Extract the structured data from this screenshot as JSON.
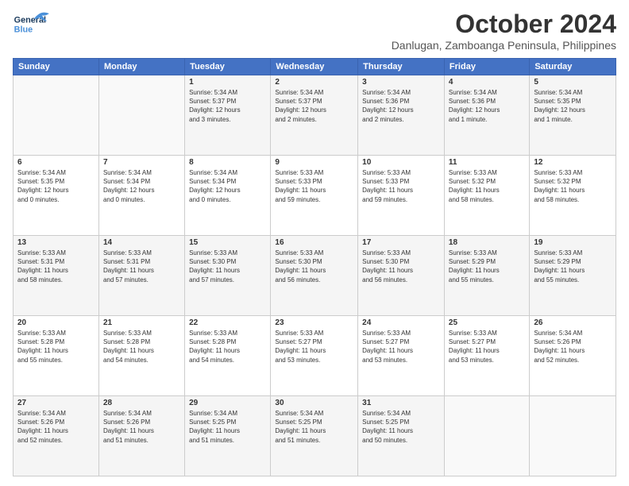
{
  "header": {
    "logo_general": "General",
    "logo_blue": "Blue",
    "month_title": "October 2024",
    "location": "Danlugan, Zamboanga Peninsula, Philippines"
  },
  "days_of_week": [
    "Sunday",
    "Monday",
    "Tuesday",
    "Wednesday",
    "Thursday",
    "Friday",
    "Saturday"
  ],
  "weeks": [
    [
      {
        "day": "",
        "info": ""
      },
      {
        "day": "",
        "info": ""
      },
      {
        "day": "1",
        "info": "Sunrise: 5:34 AM\nSunset: 5:37 PM\nDaylight: 12 hours\nand 3 minutes."
      },
      {
        "day": "2",
        "info": "Sunrise: 5:34 AM\nSunset: 5:37 PM\nDaylight: 12 hours\nand 2 minutes."
      },
      {
        "day": "3",
        "info": "Sunrise: 5:34 AM\nSunset: 5:36 PM\nDaylight: 12 hours\nand 2 minutes."
      },
      {
        "day": "4",
        "info": "Sunrise: 5:34 AM\nSunset: 5:36 PM\nDaylight: 12 hours\nand 1 minute."
      },
      {
        "day": "5",
        "info": "Sunrise: 5:34 AM\nSunset: 5:35 PM\nDaylight: 12 hours\nand 1 minute."
      }
    ],
    [
      {
        "day": "6",
        "info": "Sunrise: 5:34 AM\nSunset: 5:35 PM\nDaylight: 12 hours\nand 0 minutes."
      },
      {
        "day": "7",
        "info": "Sunrise: 5:34 AM\nSunset: 5:34 PM\nDaylight: 12 hours\nand 0 minutes."
      },
      {
        "day": "8",
        "info": "Sunrise: 5:34 AM\nSunset: 5:34 PM\nDaylight: 12 hours\nand 0 minutes."
      },
      {
        "day": "9",
        "info": "Sunrise: 5:33 AM\nSunset: 5:33 PM\nDaylight: 11 hours\nand 59 minutes."
      },
      {
        "day": "10",
        "info": "Sunrise: 5:33 AM\nSunset: 5:33 PM\nDaylight: 11 hours\nand 59 minutes."
      },
      {
        "day": "11",
        "info": "Sunrise: 5:33 AM\nSunset: 5:32 PM\nDaylight: 11 hours\nand 58 minutes."
      },
      {
        "day": "12",
        "info": "Sunrise: 5:33 AM\nSunset: 5:32 PM\nDaylight: 11 hours\nand 58 minutes."
      }
    ],
    [
      {
        "day": "13",
        "info": "Sunrise: 5:33 AM\nSunset: 5:31 PM\nDaylight: 11 hours\nand 58 minutes."
      },
      {
        "day": "14",
        "info": "Sunrise: 5:33 AM\nSunset: 5:31 PM\nDaylight: 11 hours\nand 57 minutes."
      },
      {
        "day": "15",
        "info": "Sunrise: 5:33 AM\nSunset: 5:30 PM\nDaylight: 11 hours\nand 57 minutes."
      },
      {
        "day": "16",
        "info": "Sunrise: 5:33 AM\nSunset: 5:30 PM\nDaylight: 11 hours\nand 56 minutes."
      },
      {
        "day": "17",
        "info": "Sunrise: 5:33 AM\nSunset: 5:30 PM\nDaylight: 11 hours\nand 56 minutes."
      },
      {
        "day": "18",
        "info": "Sunrise: 5:33 AM\nSunset: 5:29 PM\nDaylight: 11 hours\nand 55 minutes."
      },
      {
        "day": "19",
        "info": "Sunrise: 5:33 AM\nSunset: 5:29 PM\nDaylight: 11 hours\nand 55 minutes."
      }
    ],
    [
      {
        "day": "20",
        "info": "Sunrise: 5:33 AM\nSunset: 5:28 PM\nDaylight: 11 hours\nand 55 minutes."
      },
      {
        "day": "21",
        "info": "Sunrise: 5:33 AM\nSunset: 5:28 PM\nDaylight: 11 hours\nand 54 minutes."
      },
      {
        "day": "22",
        "info": "Sunrise: 5:33 AM\nSunset: 5:28 PM\nDaylight: 11 hours\nand 54 minutes."
      },
      {
        "day": "23",
        "info": "Sunrise: 5:33 AM\nSunset: 5:27 PM\nDaylight: 11 hours\nand 53 minutes."
      },
      {
        "day": "24",
        "info": "Sunrise: 5:33 AM\nSunset: 5:27 PM\nDaylight: 11 hours\nand 53 minutes."
      },
      {
        "day": "25",
        "info": "Sunrise: 5:33 AM\nSunset: 5:27 PM\nDaylight: 11 hours\nand 53 minutes."
      },
      {
        "day": "26",
        "info": "Sunrise: 5:34 AM\nSunset: 5:26 PM\nDaylight: 11 hours\nand 52 minutes."
      }
    ],
    [
      {
        "day": "27",
        "info": "Sunrise: 5:34 AM\nSunset: 5:26 PM\nDaylight: 11 hours\nand 52 minutes."
      },
      {
        "day": "28",
        "info": "Sunrise: 5:34 AM\nSunset: 5:26 PM\nDaylight: 11 hours\nand 51 minutes."
      },
      {
        "day": "29",
        "info": "Sunrise: 5:34 AM\nSunset: 5:25 PM\nDaylight: 11 hours\nand 51 minutes."
      },
      {
        "day": "30",
        "info": "Sunrise: 5:34 AM\nSunset: 5:25 PM\nDaylight: 11 hours\nand 51 minutes."
      },
      {
        "day": "31",
        "info": "Sunrise: 5:34 AM\nSunset: 5:25 PM\nDaylight: 11 hours\nand 50 minutes."
      },
      {
        "day": "",
        "info": ""
      },
      {
        "day": "",
        "info": ""
      }
    ]
  ]
}
